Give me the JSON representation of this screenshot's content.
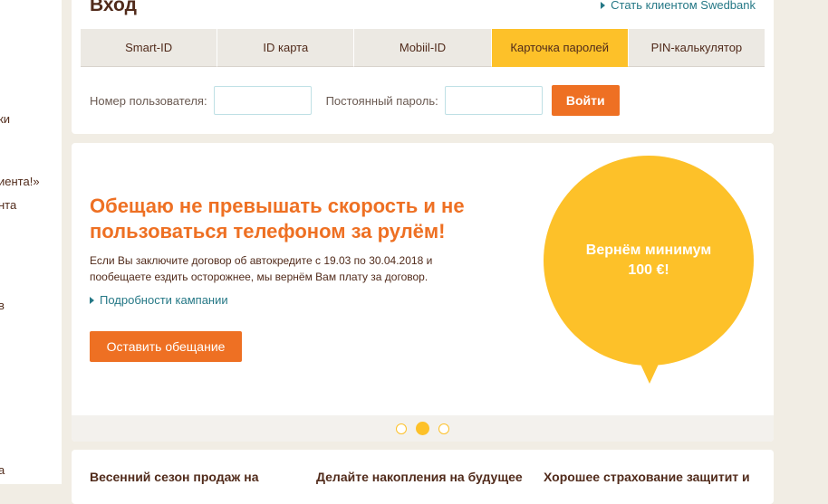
{
  "sidebar": {
    "items": [
      {
        "label": "ки"
      },
      {
        "label": "иента!»"
      },
      {
        "label": "нта"
      },
      {
        "label": "в"
      },
      {
        "label": "а"
      }
    ]
  },
  "login": {
    "title": "Вход",
    "join_link": "Стать клиентом Swedbank",
    "tabs": [
      "Smart-ID",
      "ID карта",
      "Mobiil-ID",
      "Карточка паролей",
      "PIN-калькулятор"
    ],
    "active_tab": "Карточка паролей",
    "username_label": "Номер пользователя:",
    "username_value": "",
    "password_label": "Постоянный пароль:",
    "password_value": "",
    "submit_label": "Войти"
  },
  "promo": {
    "title": "Обещаю не превышать скорость и не пользоваться телефоном за рулём!",
    "text": "Если Вы заключите договор об автокредите с 19.03 по 30.04.2018 и пообещаете ездить осторожнее, мы вернём Вам плату за договор.",
    "details_link": "Подробности кампании",
    "button_label": "Оставить обещание",
    "bubble_line1": "Вернём минимум",
    "bubble_line2": "100 €!",
    "carousel": {
      "total": 3,
      "active_index": 2
    }
  },
  "news": {
    "items": [
      "Весенний сезон продаж на",
      "Делайте накопления на будущее",
      "Хорошее страхование защитит и"
    ]
  },
  "colors": {
    "brand_orange": "#ee7023",
    "brand_yellow": "#fdc129",
    "text_brown": "#512b1b",
    "link_teal": "#257886",
    "background": "#f1ede4"
  }
}
